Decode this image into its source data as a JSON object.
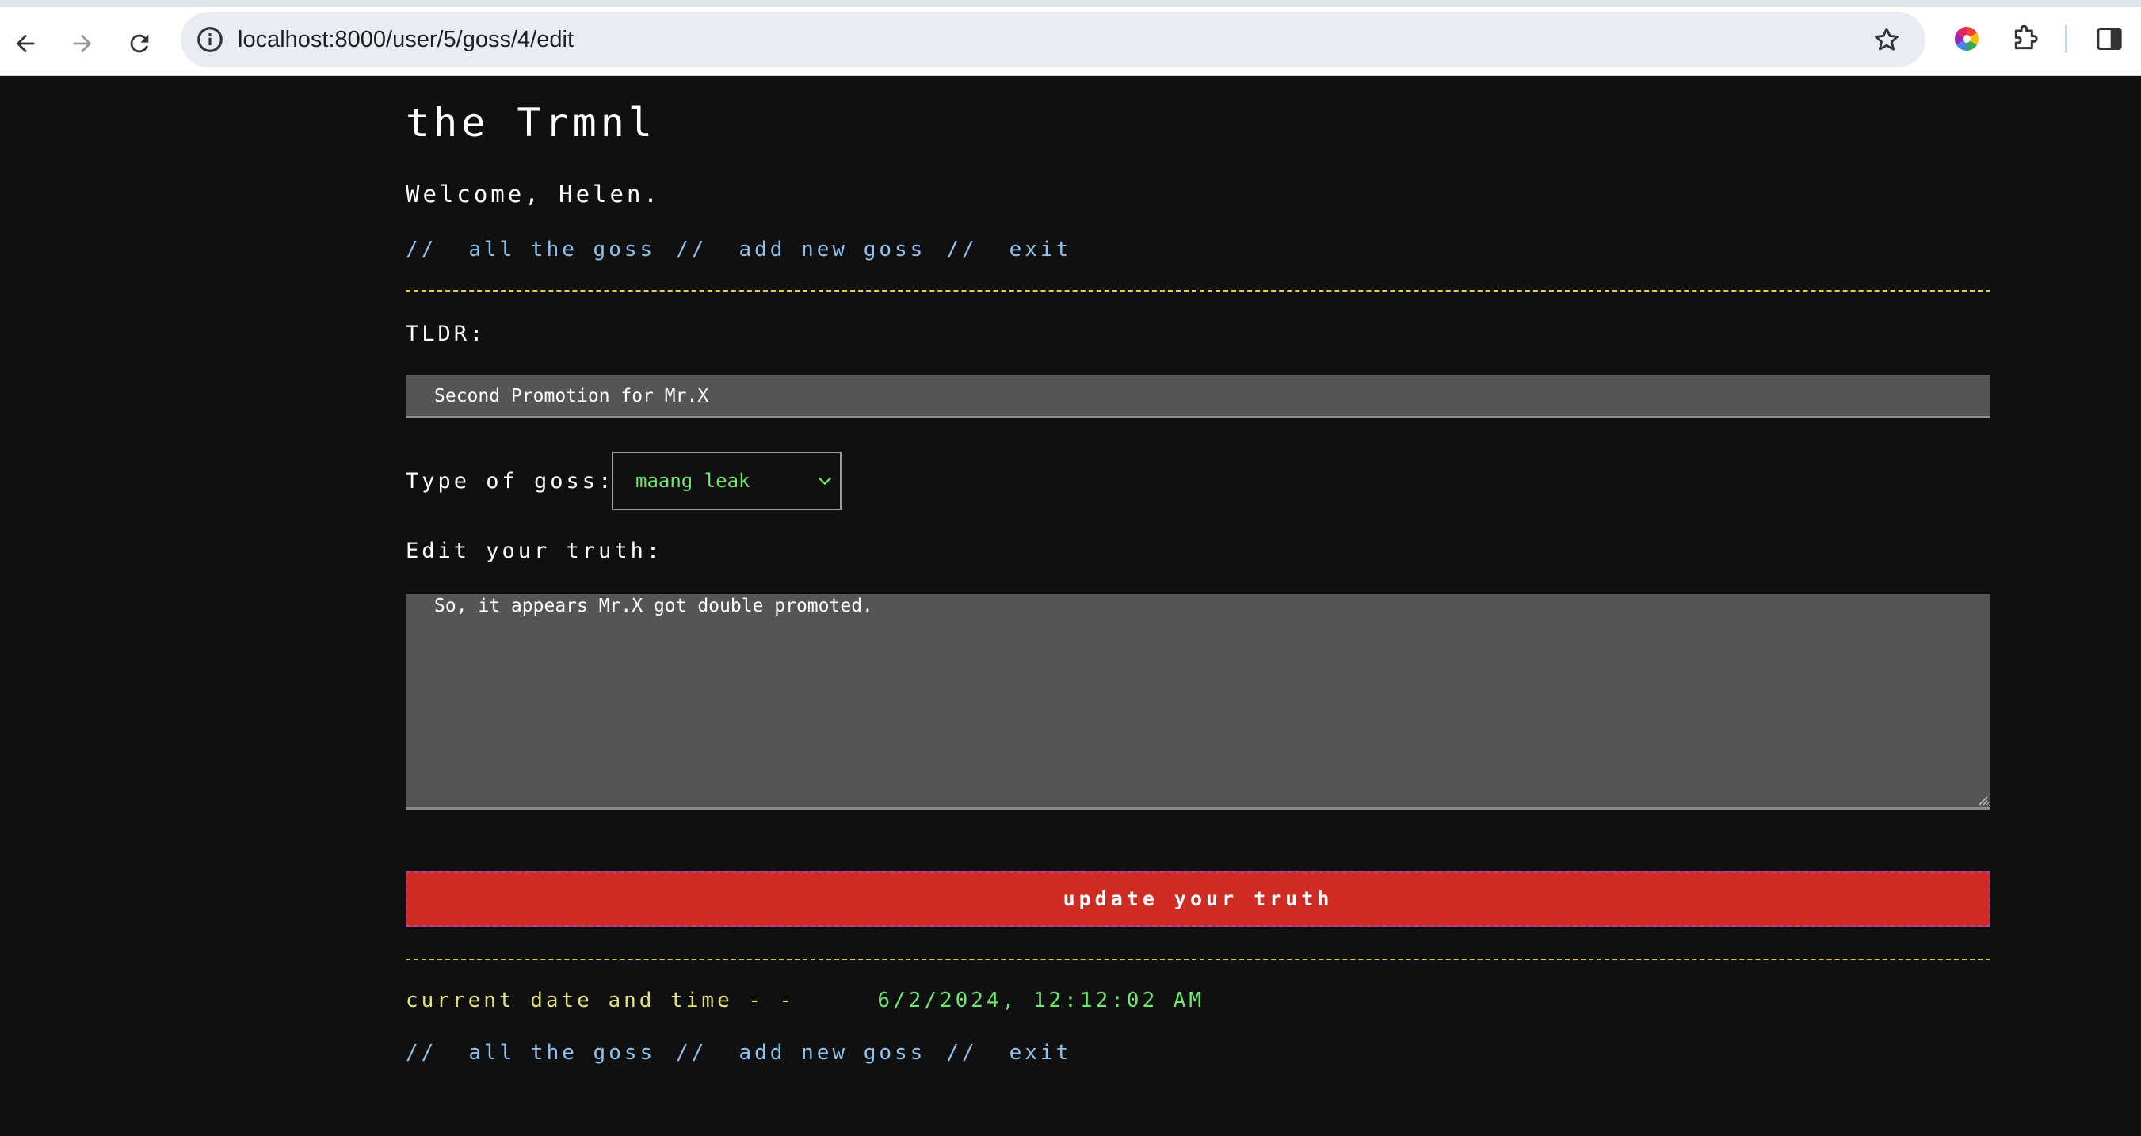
{
  "browser": {
    "url": "localhost:8000/user/5/goss/4/edit",
    "icons": {
      "back": "arrow-left-icon",
      "forward": "arrow-right-icon",
      "reload": "reload-icon",
      "site_info": "info-circle-icon",
      "bookmark": "star-icon",
      "color_extension": "color-wheel-icon",
      "extensions": "puzzle-icon",
      "side_panel": "side-panel-icon"
    }
  },
  "site": {
    "title": "the Trmnl",
    "welcome": "Welcome, Helen."
  },
  "nav": {
    "separator": "//",
    "all_goss": "all the goss",
    "add_goss": "add new goss",
    "exit": "exit"
  },
  "form": {
    "tldr_label": "TLDR:",
    "tldr_value": "Second Promotion for Mr.X",
    "type_label": "Type of goss:",
    "type_selected": "maang leak",
    "truth_label": "Edit your truth:",
    "truth_value": "So, it appears Mr.X got double promoted.",
    "submit_label": "update your truth"
  },
  "footer": {
    "datetime_label": "current date and time - -",
    "datetime_value": "6/2/2024, 12:12:02 AM"
  },
  "colors": {
    "background": "#101010",
    "link": "#8fc2ee",
    "divider": "#e0d24a",
    "input_bg": "#555555",
    "select_text": "#6ee86e",
    "button": "#d02b22",
    "date_label": "#e5e27a",
    "date_value": "#6ee86e"
  }
}
